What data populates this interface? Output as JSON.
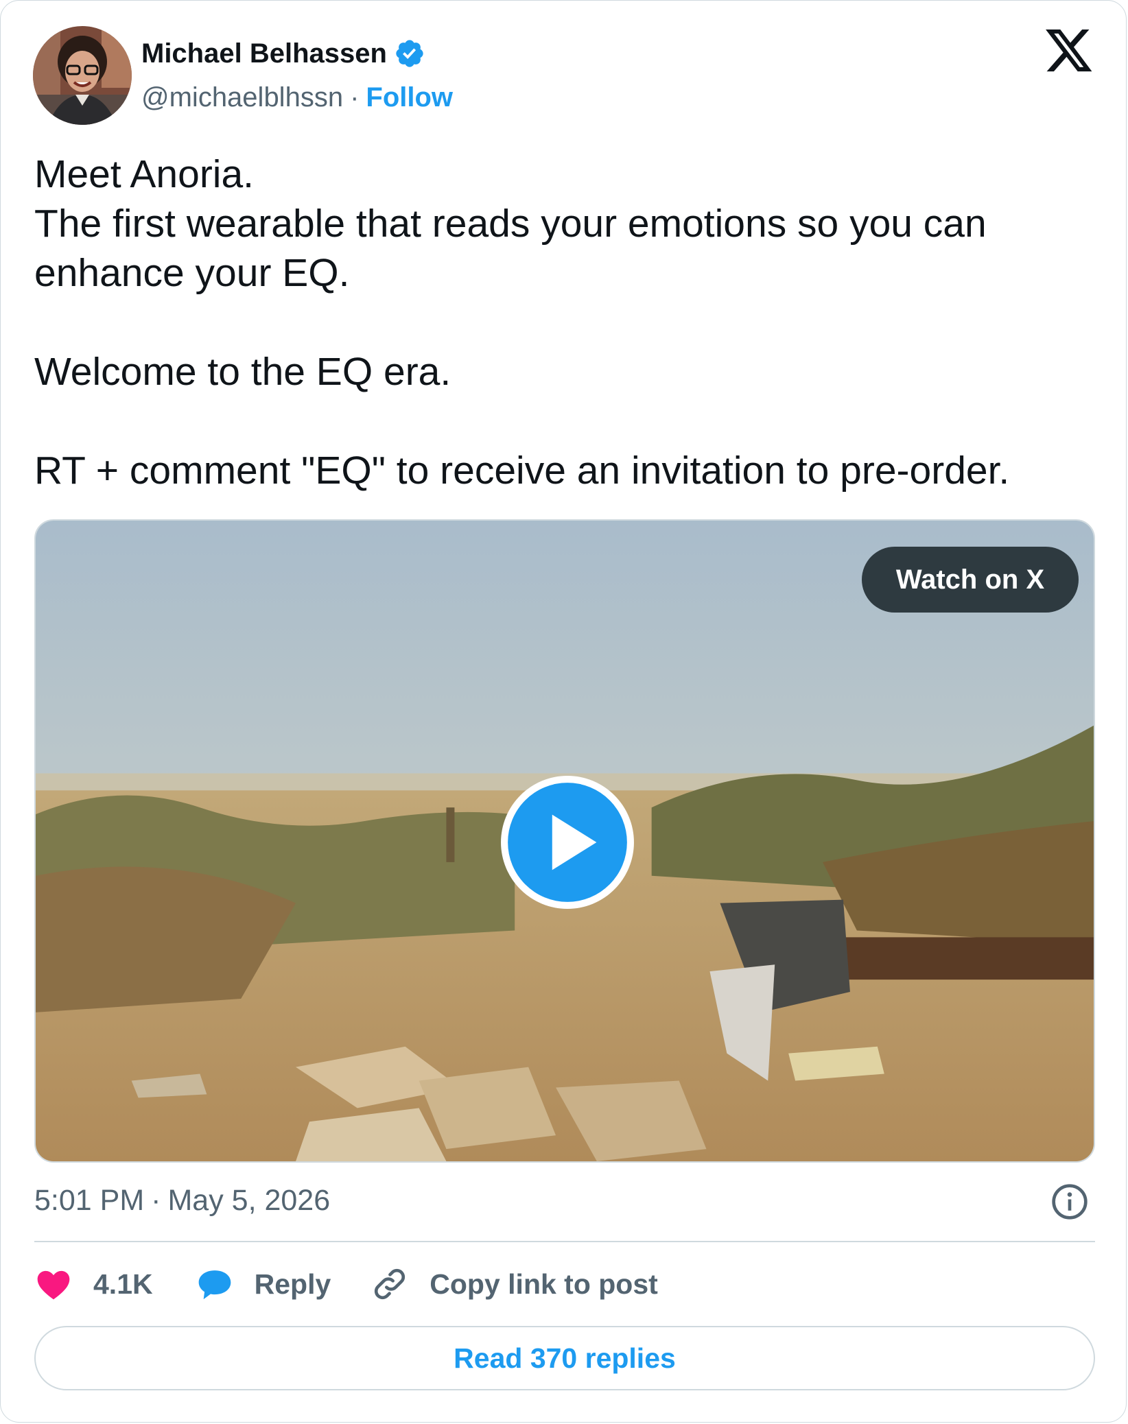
{
  "author": {
    "name": "Michael Belhassen",
    "handle": "@michaelblhssn",
    "separator": "·",
    "follow_label": "Follow",
    "verified_icon": "verified-badge-icon"
  },
  "tweet": {
    "text": "Meet Anoria.\nThe first wearable that reads your emotions so you can enhance your EQ.\n\nWelcome to the EQ era.\n\nRT + comment \"EQ\" to receive an invitation to pre-order."
  },
  "media": {
    "watch_label": "Watch on X",
    "play_icon": "play-icon"
  },
  "meta": {
    "time": "5:01 PM",
    "separator": "·",
    "date": "May 5, 2026"
  },
  "actions": {
    "likes": "4.1K",
    "reply_label": "Reply",
    "copy_label": "Copy link to post"
  },
  "read_replies_label": "Read 370 replies",
  "colors": {
    "accent": "#1d9bf0",
    "like": "#f91880",
    "text": "#0f1419",
    "secondary": "#536471",
    "border": "#cfd9de"
  }
}
